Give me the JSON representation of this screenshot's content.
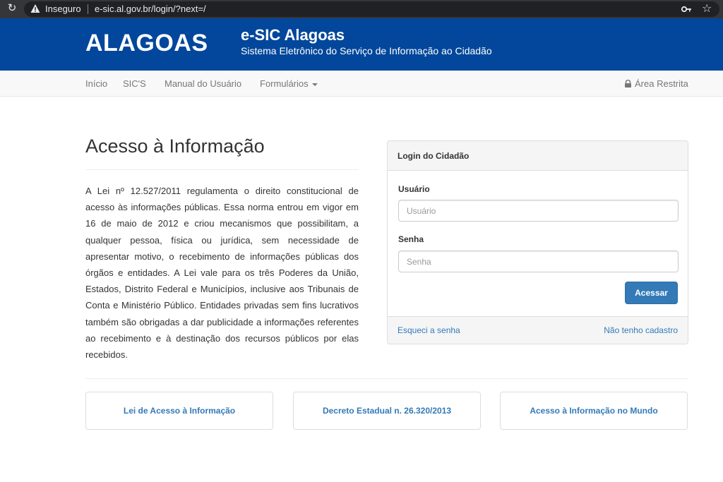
{
  "browser": {
    "security_label": "Inseguro",
    "url": "e-sic.al.gov.br/login/?next=/"
  },
  "header": {
    "logo_text": "ALAGOAS",
    "title": "e-SIC Alagoas",
    "subtitle": "Sistema Eletrônico do Serviço de Informação ao Cidadão",
    "background_color": "#02479b"
  },
  "nav": {
    "items": [
      "Início",
      "SIC'S",
      "Manual do Usuário",
      "Formulários"
    ],
    "restricted": "Área Restrita"
  },
  "main": {
    "title": "Acesso à Informação",
    "body": "A Lei nº 12.527/2011 regulamenta o direito constitucional de acesso às informações públicas. Essa norma entrou em vigor em 16 de maio de 2012 e criou mecanismos que possibilitam, a qualquer pessoa, física ou jurídica, sem necessidade de apresentar motivo, o recebimento de informações públicas dos órgãos e entidades. A Lei vale para os três Poderes da União, Estados, Distrito Federal e Municípios, inclusive aos Tribunais de Conta e Ministério Público. Entidades privadas sem fins lucrativos também são obrigadas a dar publicidade a informações referentes ao recebimento e à destinação dos recursos públicos por elas recebidos."
  },
  "login": {
    "heading": "Login do Cidadão",
    "username_label": "Usuário",
    "username_placeholder": "Usuário",
    "password_label": "Senha",
    "password_placeholder": "Senha",
    "submit_label": "Acessar",
    "forgot_label": "Esqueci a senha",
    "register_label": "Não tenho cadastro",
    "accent_color": "#337ab7"
  },
  "links": [
    {
      "label": "Lei de Acesso à Informação"
    },
    {
      "label": "Decreto Estadual n. 26.320/2013"
    },
    {
      "label": "Acesso à Informação no Mundo"
    }
  ]
}
